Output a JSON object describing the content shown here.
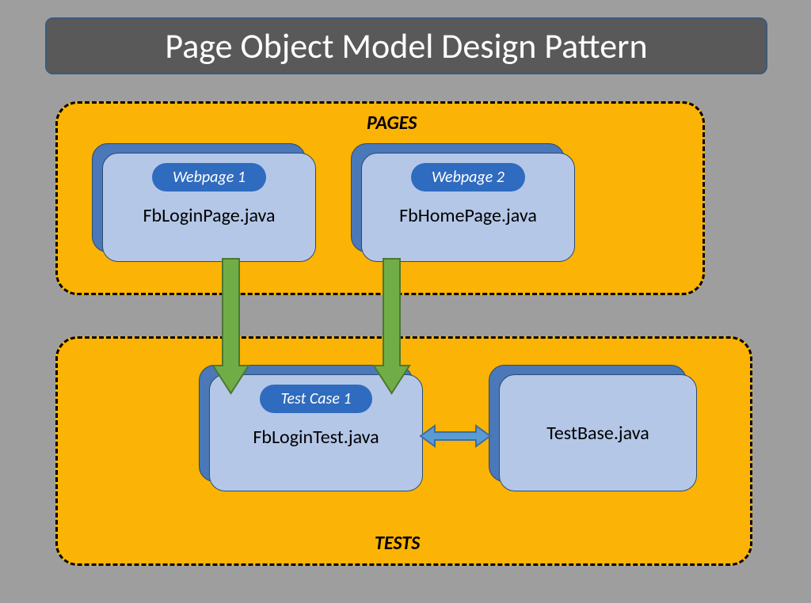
{
  "title": "Page Object Model Design Pattern",
  "pages": {
    "label": "PAGES",
    "items": [
      {
        "pill": "Webpage 1",
        "body": "FbLoginPage.java"
      },
      {
        "pill": "Webpage 2",
        "body": "FbHomePage.java"
      }
    ]
  },
  "tests": {
    "label": "TESTS",
    "items": [
      {
        "pill": "Test Case 1",
        "body": "FbLoginTest.java"
      },
      {
        "body": "TestBase.java"
      }
    ]
  },
  "colors": {
    "bg": "#9e9e9e",
    "title_bg": "#595959",
    "group_bg": "#fbb305",
    "card_front": "#b4c7e7",
    "card_shadow": "#4a78b8",
    "pill_bg": "#2f6bbf",
    "arrow_green_fill": "#70ad47",
    "arrow_blue_fill": "#5b9bd5"
  }
}
